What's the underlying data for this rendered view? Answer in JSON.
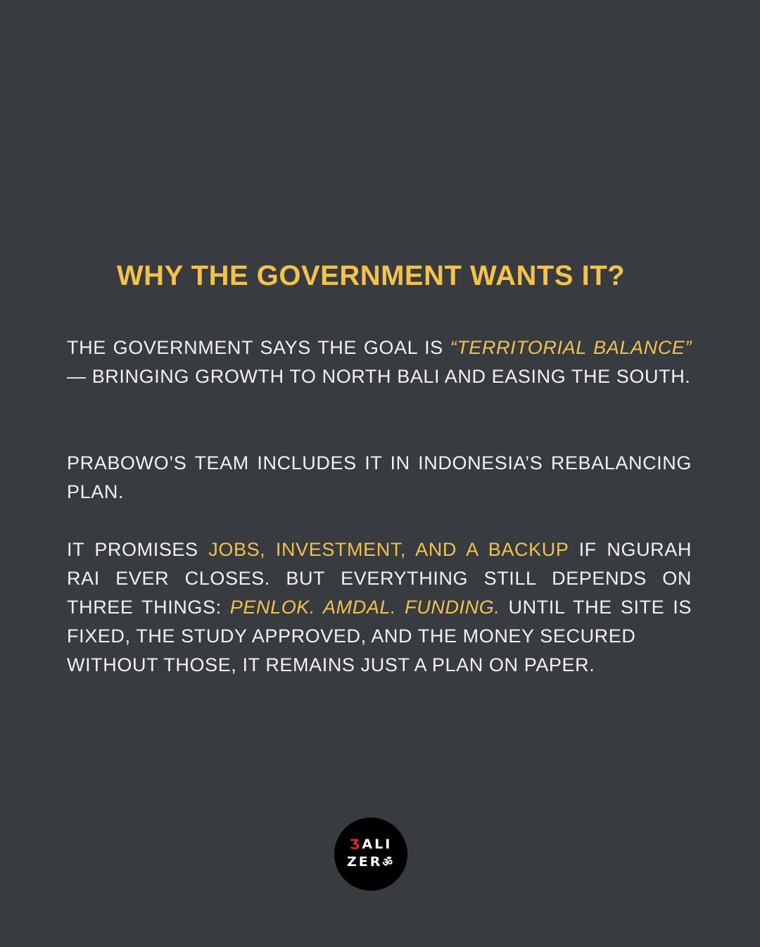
{
  "title": "WHY THE GOVERNMENT WANTS IT?",
  "paragraph1": {
    "t1": "THE GOVERNMENT SAYS THE GOAL IS ",
    "highlight": "“TERRITORIAL BALANCE”",
    "t2": " — BRINGING GROWTH TO NORTH BALI AND EASING THE SOUTH."
  },
  "paragraph2": {
    "text": "PRABOWO’S TEAM INCLUDES IT IN INDONESIA’S REBALANCING PLAN."
  },
  "paragraph3": {
    "t1": "IT PROMISES ",
    "highlight": "JOBS, INVESTMENT, AND A BACKUP",
    "t2": " IF NGURAH RAI EVER CLOSES. BUT EVERYTHING STILL DEPENDS ON THREE THINGS:  ",
    "italic": "PENLOK. AMDAL. FUNDING.",
    "t3": " UNTIL THE SITE IS FIXED, THE STUDY APPROVED, AND THE MONEY SECURED",
    "t4": "WITHOUT THOSE, IT REMAINS JUST A PLAN ON PAPER."
  },
  "logo": {
    "row1_mark": "Ʒ",
    "row1_text": "ALI",
    "row2_text": "ZER",
    "row2_mark": "ॐ"
  },
  "colors": {
    "background": "#383b3f",
    "accent": "#f3c24c",
    "text": "#f2f2f2",
    "logo_red": "#e5242b"
  }
}
